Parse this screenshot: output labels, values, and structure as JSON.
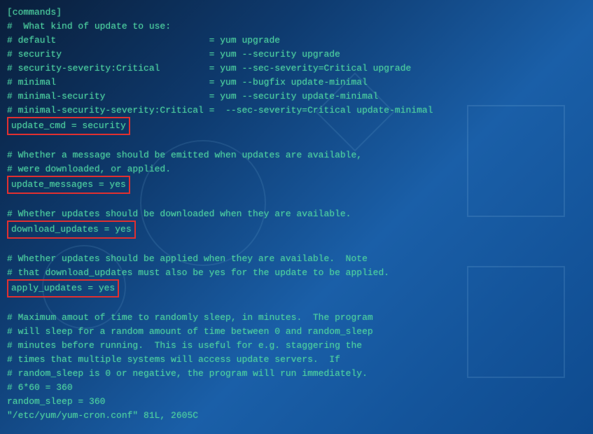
{
  "lines": {
    "section": "[commands]",
    "c1": "#  What kind of update to use:",
    "c2": "# default                            = yum upgrade",
    "c3": "# security                           = yum --security upgrade",
    "c4": "# security-severity:Critical         = yum --sec-severity=Critical upgrade",
    "c5": "# minimal                            = yum --bugfix update-minimal",
    "c6": "# minimal-security                   = yum --security update-minimal",
    "c7": "# minimal-security-severity:Critical =  --sec-severity=Critical update-minimal",
    "h1": "update_cmd = security",
    "c8": "# Whether a message should be emitted when updates are available,",
    "c9": "# were downloaded, or applied.",
    "h2": "update_messages = yes",
    "c10": "# Whether updates should be downloaded when they are available.",
    "h3": "download_updates = yes",
    "c11": "# Whether updates should be applied when they are available.  Note",
    "c12": "# that download_updates must also be yes for the update to be applied.",
    "h4": "apply_updates = yes",
    "c13": "# Maximum amout of time to randomly sleep, in minutes.  The program",
    "c14": "# will sleep for a random amount of time between 0 and random_sleep",
    "c15": "# minutes before running.  This is useful for e.g. staggering the",
    "c16": "# times that multiple systems will access update servers.  If",
    "c17": "# random_sleep is 0 or negative, the program will run immediately.",
    "c18": "# 6*60 = 360",
    "v1": "random_sleep = 360",
    "status": "\"/etc/yum/yum-cron.conf\" 81L, 2605C"
  }
}
